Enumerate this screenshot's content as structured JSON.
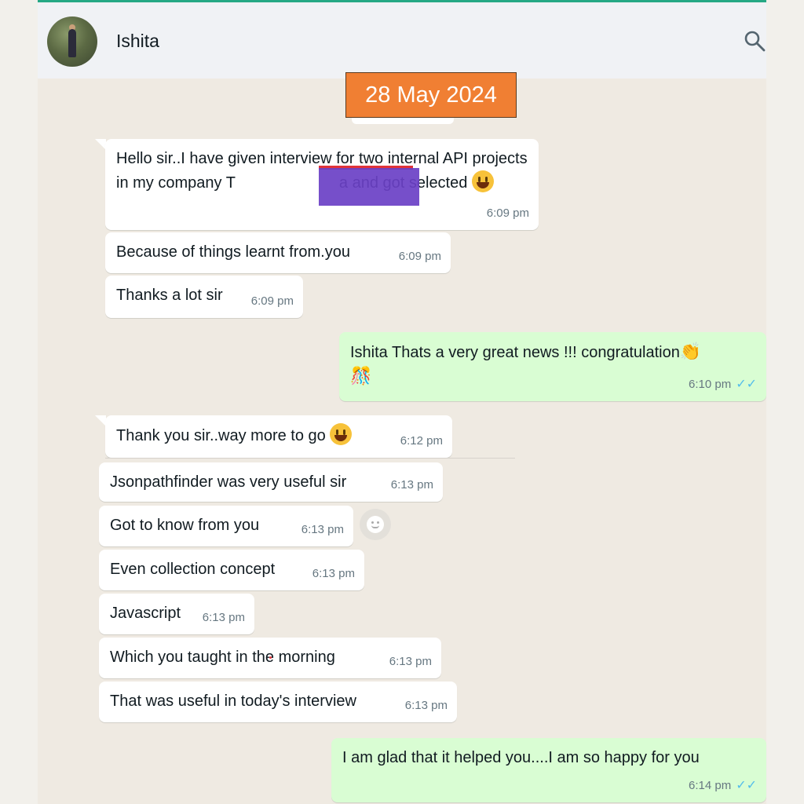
{
  "header": {
    "contact_name": "Ishita",
    "search_icon": "search-icon",
    "avatar_icon": "avatar"
  },
  "date_badge": "28 May 2024",
  "messages": [
    {
      "direction": "in",
      "text": "Hello sir..I have given interview for two internal API projects in my company T",
      "text_after": "a and got selected",
      "time": "6:09 pm"
    },
    {
      "direction": "in",
      "text": "Because of things learnt from.you",
      "time": "6:09 pm"
    },
    {
      "direction": "in",
      "text": "Thanks a lot sir",
      "time": "6:09 pm"
    },
    {
      "direction": "out",
      "text": "Ishita Thats a very great news !!! congratulation",
      "time": "6:10 pm"
    },
    {
      "direction": "in",
      "text": "Thank you sir..way more to go",
      "time": "6:12 pm"
    },
    {
      "direction": "in",
      "text": "Jsonpathfinder was very useful sir",
      "time": "6:13 pm"
    },
    {
      "direction": "in",
      "text": "Got to know from you",
      "time": "6:13 pm"
    },
    {
      "direction": "in",
      "text": "Even collection concept",
      "time": "6:13 pm"
    },
    {
      "direction": "in",
      "text": "Javascript",
      "time": "6:13 pm"
    },
    {
      "direction": "in",
      "text": "Which you taught in the morning",
      "time": "6:13 pm"
    },
    {
      "direction": "in",
      "text": "That was useful in today's interview",
      "time": "6:13 pm"
    },
    {
      "direction": "out",
      "text": "I am glad that it helped you....I am so happy for you",
      "time": "6:14 pm"
    }
  ],
  "colors": {
    "incoming": "#ffffff",
    "outgoing": "#d9fdd3",
    "badge": "#f07f33",
    "redaction": "#6a40c6",
    "ticks": "#53bdeb"
  }
}
